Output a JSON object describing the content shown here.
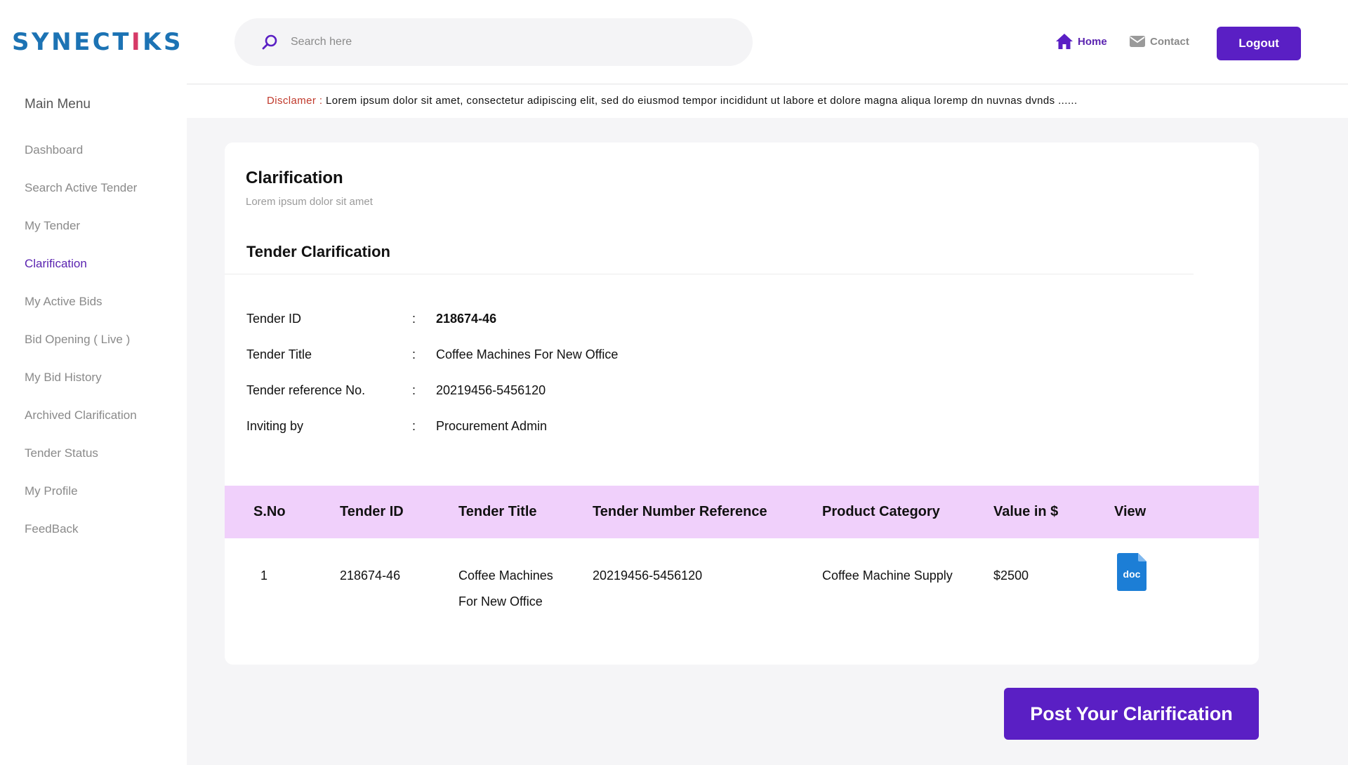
{
  "brand": {
    "logo_pre": "SYNECT",
    "logo_i": "I",
    "logo_post": "KS"
  },
  "sidebar": {
    "title": "Main Menu",
    "items": [
      {
        "label": "Dashboard",
        "active": false
      },
      {
        "label": "Search Active Tender",
        "active": false
      },
      {
        "label": "My Tender",
        "active": false
      },
      {
        "label": "Clarification",
        "active": true
      },
      {
        "label": "My Active Bids",
        "active": false
      },
      {
        "label": "Bid Opening ( Live )",
        "active": false
      },
      {
        "label": "My Bid History",
        "active": false
      },
      {
        "label": "Archived Clarification",
        "active": false
      },
      {
        "label": "Tender Status",
        "active": false
      },
      {
        "label": "My Profile",
        "active": false
      },
      {
        "label": "FeedBack",
        "active": false
      }
    ]
  },
  "header": {
    "search_placeholder": "Search here",
    "home_label": "Home",
    "contact_label": "Contact",
    "logout_label": "Logout"
  },
  "disclaimer": {
    "label": "Disclamer :",
    "text": "Lorem ipsum dolor sit amet, consectetur adipiscing elit, sed do eiusmod tempor incididunt ut labore et dolore magna aliqua loremp dn  nuvnas dvnds ......"
  },
  "page": {
    "title": "Clarification",
    "subtitle": "Lorem ipsum dolor sit amet",
    "section_title": "Tender Clarification"
  },
  "tender_info": [
    {
      "label": "Tender ID",
      "sep": ":",
      "value": "218674-46"
    },
    {
      "label": "Tender Title",
      "sep": ":",
      "value": "Coffee Machines For New Office"
    },
    {
      "label": "Tender reference No.",
      "sep": ":",
      "value": "20219456-5456120"
    },
    {
      "label": "Inviting by",
      "sep": ":",
      "value": "Procurement Admin"
    }
  ],
  "table": {
    "columns": [
      "S.No",
      "Tender ID",
      "Tender Title",
      "Tender Number Reference",
      "Product Category",
      "Value in $",
      "View"
    ],
    "rows": [
      {
        "sno": "1",
        "tender_id": "218674-46",
        "title_line1": "Coffee Machines",
        "title_line2": "For New Office",
        "reference": "20219456-5456120",
        "category": "Coffee Machine Supply",
        "value": "$2500",
        "view_label": "doc"
      }
    ]
  },
  "post_button_label": "Post Your Clarification",
  "colors": {
    "primary": "#5a1fc4",
    "brand_blue": "#1c73b4",
    "brand_accent": "#d63a67",
    "table_header": "#f0d0fb",
    "disclaimer_label": "#c0392b",
    "doc_icon": "#1c7ed6"
  },
  "icons": {
    "search": "search-icon",
    "home": "home-icon",
    "contact": "mail-icon",
    "view": "doc-file-icon"
  }
}
